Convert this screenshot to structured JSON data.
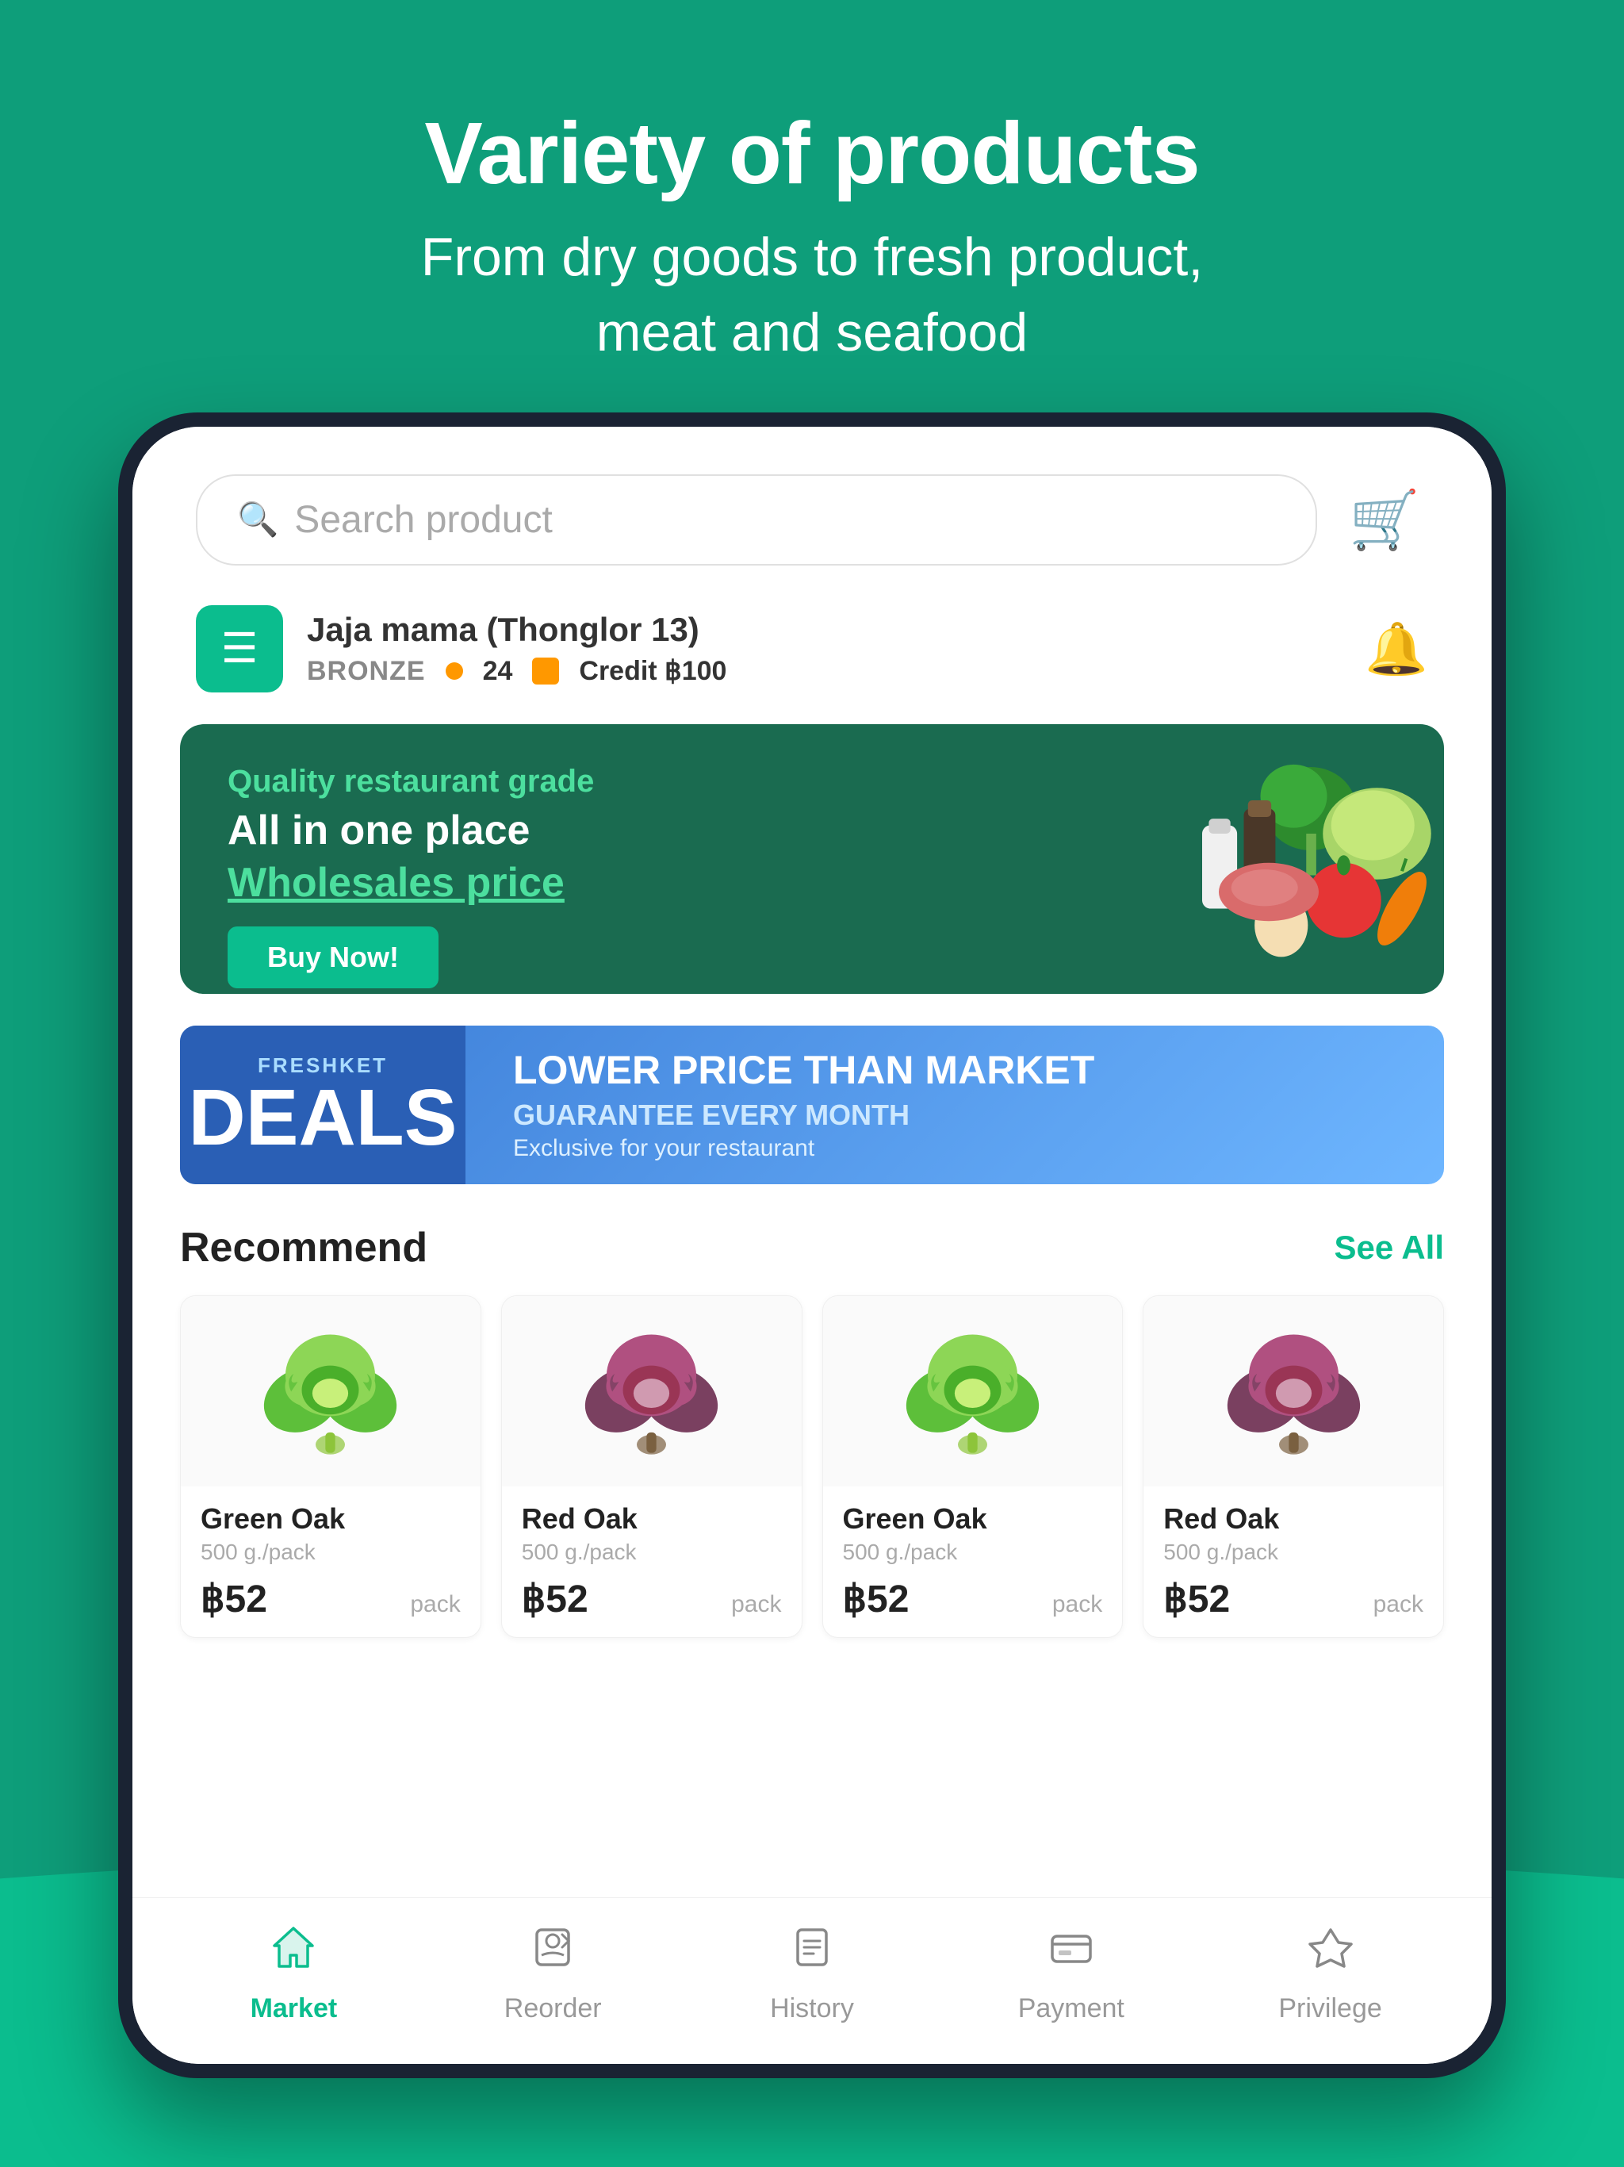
{
  "header": {
    "title": "Variety of products",
    "subtitle_line1": "From dry goods to fresh product,",
    "subtitle_line2": "meat and seafood"
  },
  "search": {
    "placeholder": "Search product"
  },
  "store": {
    "name": "Jaja mama (Thonglor 13)",
    "tier": "BRONZE",
    "points": "24",
    "credit_label": "Credit ฿100"
  },
  "banner": {
    "quality_label": "Quality restaurant grade",
    "main_line1": "All in one place",
    "main_line2": "Wholesales price",
    "cta": "Buy Now!"
  },
  "deals": {
    "brand": "FRESHKET",
    "big_label": "DEALS",
    "headline": "LOWER PRICE THAN MARKET",
    "subline": "GUARANTEE EVERY MONTH",
    "extra": "Exclusive for your restaurant"
  },
  "recommend": {
    "title": "Recommend",
    "see_all": "See All",
    "products": [
      {
        "name": "Green Oak",
        "unit": "500 g./pack",
        "price": "฿52",
        "per": "pack",
        "type": "green"
      },
      {
        "name": "Red Oak",
        "unit": "500 g./pack",
        "price": "฿52",
        "per": "pack",
        "type": "red"
      },
      {
        "name": "Green Oak",
        "unit": "500 g./pack",
        "price": "฿52",
        "per": "pack",
        "type": "green"
      },
      {
        "name": "Red Oak",
        "unit": "500 g./pack",
        "price": "฿52",
        "per": "pack",
        "type": "red"
      }
    ]
  },
  "bottom_nav": {
    "items": [
      {
        "id": "market",
        "label": "Market",
        "active": true
      },
      {
        "id": "reorder",
        "label": "Reorder",
        "active": false
      },
      {
        "id": "history",
        "label": "History",
        "active": false
      },
      {
        "id": "payment",
        "label": "Payment",
        "active": false
      },
      {
        "id": "privilege",
        "label": "Privilege",
        "active": false
      }
    ]
  },
  "colors": {
    "primary": "#0bbd8e",
    "dark_teal": "#1a6b50",
    "blue": "#3a7bd5"
  }
}
